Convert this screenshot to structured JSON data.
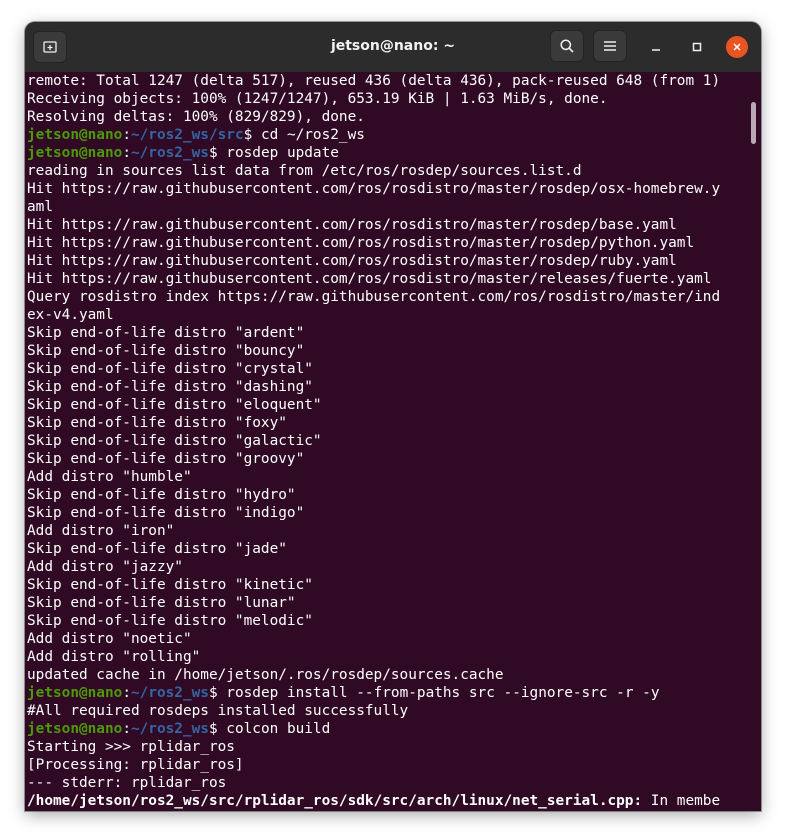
{
  "window": {
    "title": "jetson@nano: ~",
    "controls": {
      "new_tab_icon": "new-tab-icon",
      "search_icon": "search-icon",
      "menu_icon": "hamburger-menu-icon",
      "minimize_icon": "minimize-icon",
      "maximize_icon": "maximize-icon",
      "close_icon": "close-icon"
    },
    "colors": {
      "titlebar": "#2c2c2c",
      "background": "#300a24",
      "text": "#ffffff",
      "prompt_user": "#4e9a06",
      "prompt_path": "#3465a4",
      "close_button": "#e95420"
    }
  },
  "terminal": {
    "lines": [
      {
        "text": "remote: Total 1247 (delta 517), reused 436 (delta 436), pack-reused 648 (from 1)"
      },
      {
        "text": "Receiving objects: 100% (1247/1247), 653.19 KiB | 1.63 MiB/s, done."
      },
      {
        "text": "Resolving deltas: 100% (829/829), done."
      },
      {
        "user": "jetson@nano",
        "sep": ":",
        "path": "~/ros2_ws/src",
        "cmd": "$ cd ~/ros2_ws"
      },
      {
        "user": "jetson@nano",
        "sep": ":",
        "path": "~/ros2_ws",
        "cmd": "$ rosdep update"
      },
      {
        "text": "reading in sources list data from /etc/ros/rosdep/sources.list.d"
      },
      {
        "text": "Hit https://raw.githubusercontent.com/ros/rosdistro/master/rosdep/osx-homebrew.y"
      },
      {
        "text": "aml"
      },
      {
        "text": "Hit https://raw.githubusercontent.com/ros/rosdistro/master/rosdep/base.yaml"
      },
      {
        "text": "Hit https://raw.githubusercontent.com/ros/rosdistro/master/rosdep/python.yaml"
      },
      {
        "text": "Hit https://raw.githubusercontent.com/ros/rosdistro/master/rosdep/ruby.yaml"
      },
      {
        "text": "Hit https://raw.githubusercontent.com/ros/rosdistro/master/releases/fuerte.yaml"
      },
      {
        "text": "Query rosdistro index https://raw.githubusercontent.com/ros/rosdistro/master/ind"
      },
      {
        "text": "ex-v4.yaml"
      },
      {
        "text": "Skip end-of-life distro \"ardent\""
      },
      {
        "text": "Skip end-of-life distro \"bouncy\""
      },
      {
        "text": "Skip end-of-life distro \"crystal\""
      },
      {
        "text": "Skip end-of-life distro \"dashing\""
      },
      {
        "text": "Skip end-of-life distro \"eloquent\""
      },
      {
        "text": "Skip end-of-life distro \"foxy\""
      },
      {
        "text": "Skip end-of-life distro \"galactic\""
      },
      {
        "text": "Skip end-of-life distro \"groovy\""
      },
      {
        "text": "Add distro \"humble\""
      },
      {
        "text": "Skip end-of-life distro \"hydro\""
      },
      {
        "text": "Skip end-of-life distro \"indigo\""
      },
      {
        "text": "Add distro \"iron\""
      },
      {
        "text": "Skip end-of-life distro \"jade\""
      },
      {
        "text": "Add distro \"jazzy\""
      },
      {
        "text": "Skip end-of-life distro \"kinetic\""
      },
      {
        "text": "Skip end-of-life distro \"lunar\""
      },
      {
        "text": "Skip end-of-life distro \"melodic\""
      },
      {
        "text": "Add distro \"noetic\""
      },
      {
        "text": "Add distro \"rolling\""
      },
      {
        "text": "updated cache in /home/jetson/.ros/rosdep/sources.cache"
      },
      {
        "user": "jetson@nano",
        "sep": ":",
        "path": "~/ros2_ws",
        "cmd": "$ rosdep install --from-paths src --ignore-src -r -y"
      },
      {
        "text": "#All required rosdeps installed successfully"
      },
      {
        "user": "jetson@nano",
        "sep": ":",
        "path": "~/ros2_ws",
        "cmd": "$ colcon build"
      },
      {
        "text": "Starting >>> rplidar_ros"
      },
      {
        "text": "[Processing: rplidar_ros]"
      },
      {
        "text": "--- stderr: rplidar_ros"
      },
      {
        "bold": "/home/jetson/ros2_ws/src/rplidar_ros/sdk/src/arch/linux/net_serial.cpp:",
        "text": " In membe"
      }
    ]
  }
}
